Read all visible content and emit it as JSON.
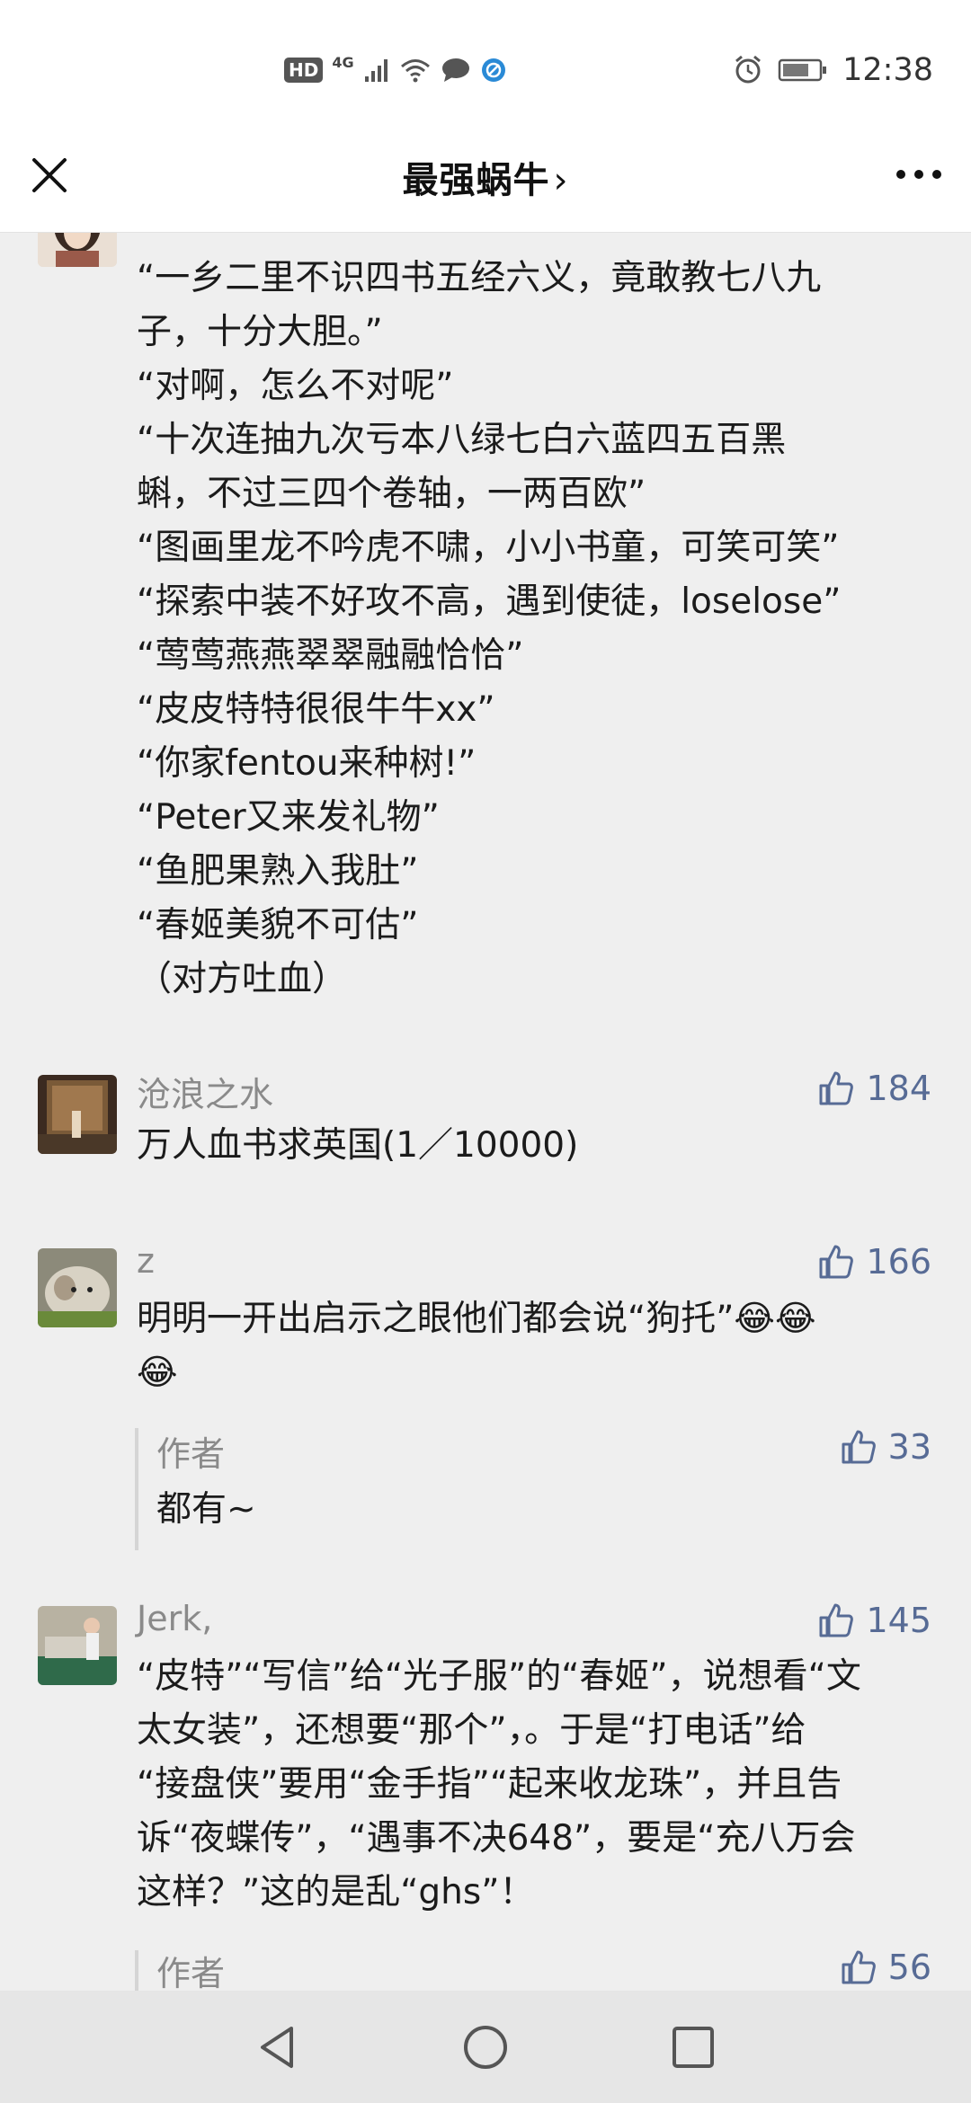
{
  "status_bar": {
    "hd_label": "HD",
    "network_label": "4G",
    "time": "12:38"
  },
  "nav": {
    "title": "最强蜗牛",
    "title_chevron": "›",
    "close_icon": "close-icon",
    "more_icon": "more-icon"
  },
  "comments": [
    {
      "text": "“一乡二里不识四书五经六义，竟敢教七八九\n子，十分大胆。”\n“对啊，怎么不对呢”\n“十次连抽九次亏本八绿七白六蓝四五百黑\n蝌，不过三四个卷轴，一两百欧”\n“图画里龙不吟虎不啸，小小书童，可笑可笑”\n“探索中装不好攻不高，遇到使徒，loselose”\n“莺莺燕燕翠翠融融恰恰”\n“皮皮特特很很牛牛xx”\n“你家fentou来种树!”\n“Peter又来发礼物”\n“鱼肥果熟入我肚”\n“春姬美貌不可估”\n（对方吐血）"
    },
    {
      "name": "沧浪之水",
      "likes": "184",
      "text": "万人血书求英国(1／10000)"
    },
    {
      "name": "z",
      "likes": "166",
      "text": "明明一开出启示之眼他们都会说“狗托”😂😂\n😂",
      "reply": {
        "name": "作者",
        "likes": "33",
        "text": "都有~"
      }
    },
    {
      "name": "Jerk,",
      "likes": "145",
      "text": "“皮特”“写信”给“光子服”的“春姬”，说想看“文\n太女装”，还想要“那个”，。于是“打电话”给\n“接盘侠”要用“金手指”“起来收龙珠”，并且告\n诉“夜蝶传”，“遇事不决648”，要是“充八万会\n这样？”这的是乱“ghs”！",
      "reply": {
        "name": "作者",
        "likes": "56"
      }
    }
  ],
  "colors": {
    "background": "#efefef",
    "like_blue": "#576b95",
    "name_gray": "#8a8a8a"
  }
}
